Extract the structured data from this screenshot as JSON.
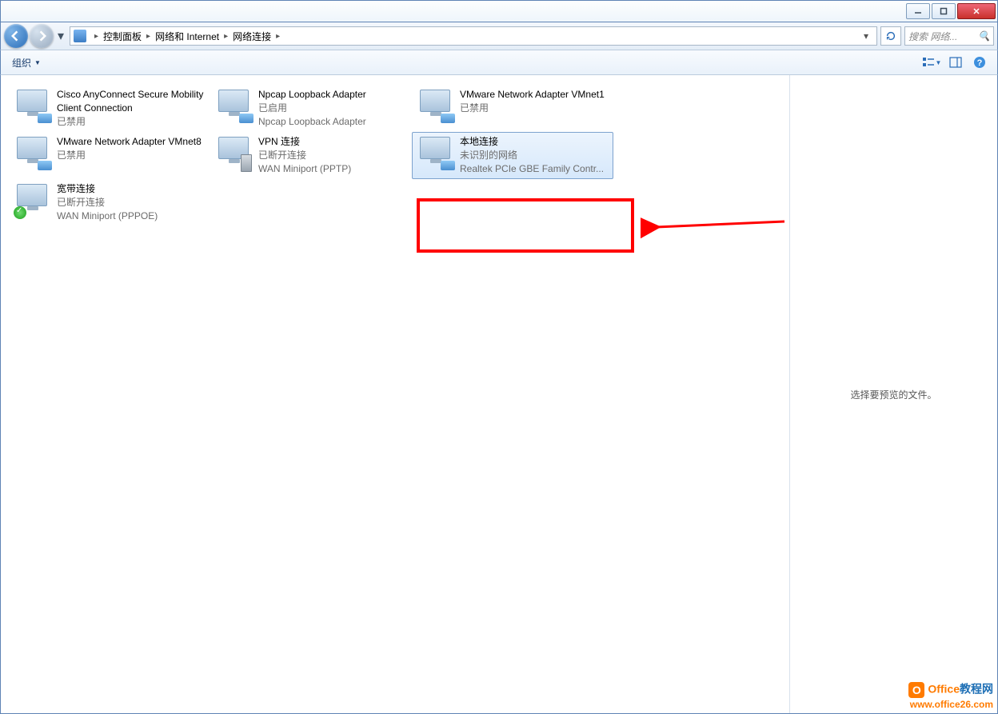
{
  "titlebar": {
    "minimize": "—",
    "maximize": "▢",
    "close": "✕"
  },
  "breadcrumb": {
    "items": [
      "控制面板",
      "网络和 Internet",
      "网络连接"
    ],
    "sep": "▸"
  },
  "search": {
    "placeholder": "搜索 网络...",
    "icon": "🔍"
  },
  "toolbar": {
    "organize": "组织",
    "dd": "▼",
    "view_icon": "☰",
    "preview_icon": "▭",
    "help_icon": "?"
  },
  "connections": [
    {
      "title": "Cisco AnyConnect Secure Mobility Client Connection",
      "line2": "已禁用",
      "line3": "",
      "badge": "net"
    },
    {
      "title": "Npcap Loopback Adapter",
      "line2": "已启用",
      "line3": "Npcap Loopback Adapter",
      "badge": "net"
    },
    {
      "title": "VMware Network Adapter VMnet1",
      "line2": "已禁用",
      "line3": "",
      "badge": "net"
    },
    {
      "title": "VMware Network Adapter VMnet8",
      "line2": "已禁用",
      "line3": "",
      "badge": "net"
    },
    {
      "title": "VPN 连接",
      "line2": "已断开连接",
      "line3": "WAN Miniport (PPTP)",
      "badge": "srv"
    },
    {
      "title": "本地连接",
      "line2": "未识别的网络",
      "line3": "Realtek PCIe GBE Family Contr...",
      "badge": "net",
      "selected": true
    },
    {
      "title": "宽带连接",
      "line2": "已断开连接",
      "line3": "WAN Miniport (PPPOE)",
      "badge": "ok"
    }
  ],
  "preview": {
    "empty": "选择要预览的文件。"
  },
  "watermark": {
    "line1_a": "Office",
    "line1_b": "教程网",
    "line2": "www.office26.com",
    "badge": "O"
  }
}
